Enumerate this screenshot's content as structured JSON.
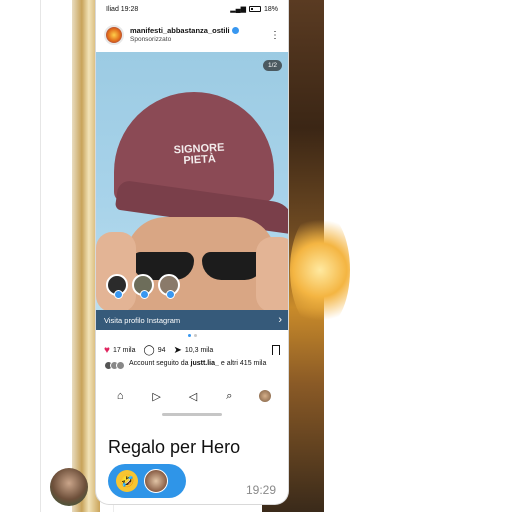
{
  "status_bar": {
    "carrier_time": "Iliad 19:28",
    "battery": "18%"
  },
  "post": {
    "username": "manifesti_abbastanza_ostili",
    "sponsored_label": "Sponsorizzato",
    "image_counter": "1/2",
    "cap_text_line1": "SIGNORE",
    "cap_text_line2": "PIETÀ",
    "visit_profile_label": "Visita profilo Instagram",
    "likes": "17 mila",
    "comments": "94",
    "shares": "10,3 mila",
    "followers_text_prefix": "Account seguito da ",
    "followers_user": "justt.lia_",
    "followers_text_suffix": " e altri 415 mila"
  },
  "caption": "Regalo per Hero",
  "reaction_emoji": "🤣",
  "timestamp": "19:29",
  "colors": {
    "accent_blue": "#3897f0",
    "like_red": "#e0245e",
    "visit_bar": "#365a7a",
    "react_pill": "#2f95e8"
  },
  "icons": [
    "heart-icon",
    "comment-icon",
    "share-icon",
    "bookmark-icon",
    "home-icon",
    "reels-icon",
    "send-icon",
    "search-icon",
    "profile-icon",
    "more-icon",
    "chevron-right-icon"
  ]
}
